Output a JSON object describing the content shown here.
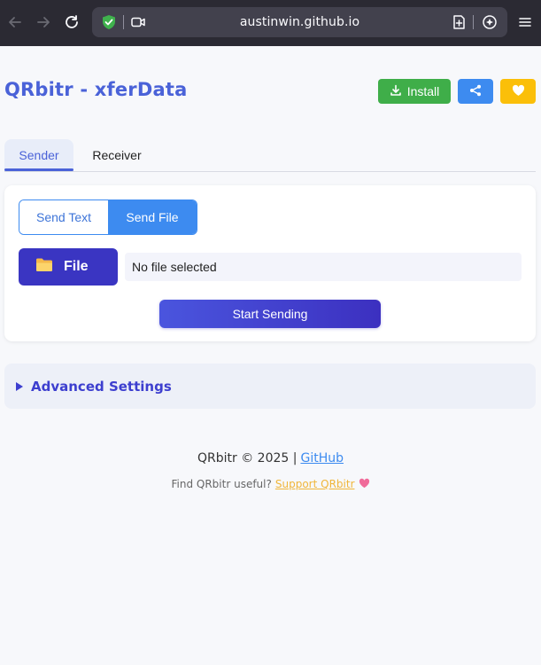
{
  "browser": {
    "url": "austinwin.github.io",
    "icons": {
      "back": "back-arrow-icon",
      "forward": "forward-arrow-icon",
      "reload": "reload-icon",
      "shield": "shield-check-icon",
      "camera": "camera-permission-icon",
      "bookmark": "bookmark-add-icon",
      "assistant": "assistant-icon",
      "menu": "hamburger-menu-icon"
    }
  },
  "header": {
    "title": "QRbitr - xferData",
    "install_label": "Install",
    "colors": {
      "title": "#4a62d8",
      "install": "#3fae49",
      "share": "#3d8bf0",
      "favorite": "#fbbf09"
    }
  },
  "tabs": [
    {
      "label": "Sender",
      "active": true
    },
    {
      "label": "Receiver",
      "active": false
    }
  ],
  "sender": {
    "modes": [
      {
        "label": "Send Text",
        "active": false
      },
      {
        "label": "Send File",
        "active": true
      }
    ],
    "file_button_label": "File",
    "file_status": "No file selected",
    "start_label": "Start Sending"
  },
  "advanced": {
    "label": "Advanced Settings"
  },
  "footer": {
    "copyright": "QRbitr © 2025 |",
    "github_link": "GitHub",
    "useful_text": "Find QRbitr useful?",
    "support_link": "Support QRbitr"
  }
}
